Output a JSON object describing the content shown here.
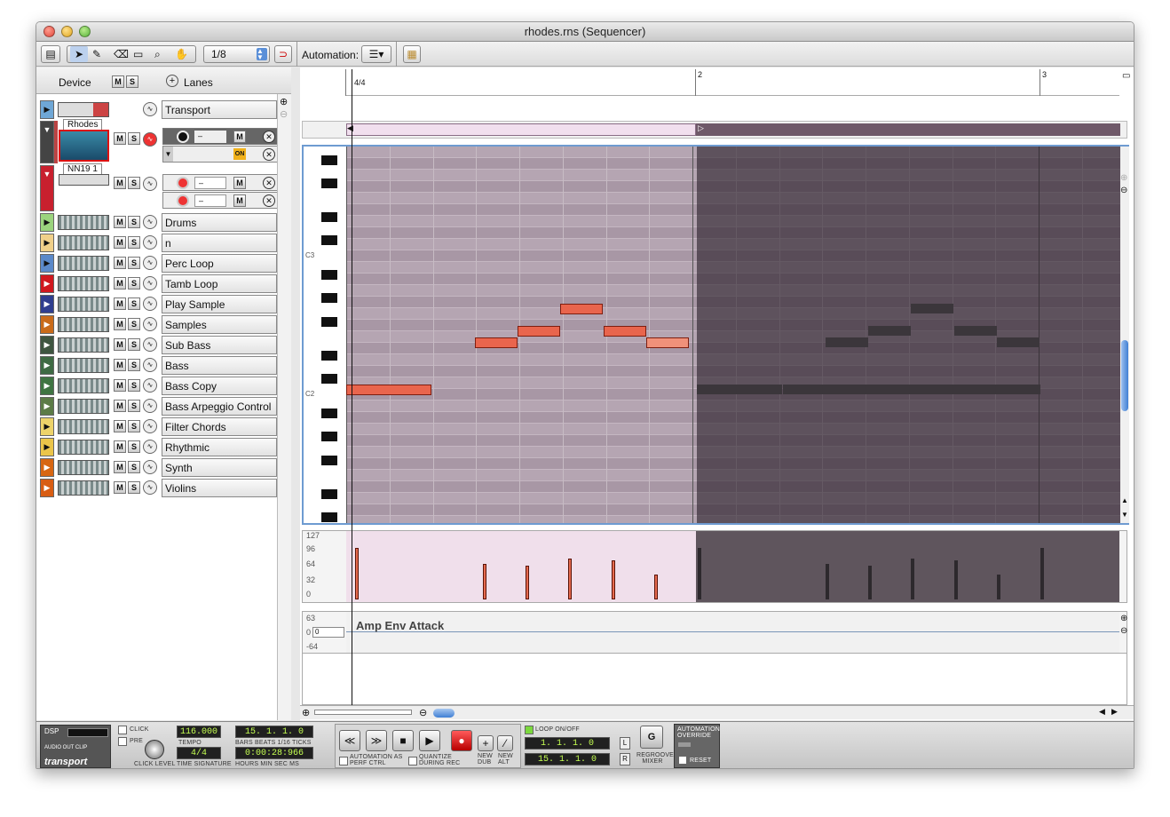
{
  "window": {
    "title": "rhodes.rns (Sequencer)"
  },
  "toolbar": {
    "grid_value": "1/8",
    "automation_label": "Automation:"
  },
  "left_header": {
    "device_label": "Device",
    "mute": "M",
    "solo": "S",
    "lanes_label": "Lanes"
  },
  "tracks": [
    {
      "name": "Transport",
      "color": "#6fa7d6"
    },
    {
      "name": "Rhodes",
      "color": "#444444"
    },
    {
      "name": "NN19 1",
      "color": "#c8202e"
    },
    {
      "name": "Drums",
      "color": "#9bd47e"
    },
    {
      "name": "n",
      "color": "#f0d08a"
    },
    {
      "name": "Perc Loop",
      "color": "#5b89c9"
    },
    {
      "name": "Tamb Loop",
      "color": "#d0181f"
    },
    {
      "name": "Play Sample",
      "color": "#2f3e8f"
    },
    {
      "name": "Samples",
      "color": "#c96b1a"
    },
    {
      "name": "Sub Bass",
      "color": "#3e5540"
    },
    {
      "name": "Bass",
      "color": "#3e6a43"
    },
    {
      "name": "Bass Copy",
      "color": "#3f7442"
    },
    {
      "name": "Bass Arpeggio  Control",
      "color": "#5c7b47"
    },
    {
      "name": "Filter Chords",
      "color": "#edd36a"
    },
    {
      "name": "Rhythmic",
      "color": "#ebc54a"
    },
    {
      "name": "Synth",
      "color": "#d76612"
    },
    {
      "name": "Violins",
      "color": "#d85d13"
    }
  ],
  "rhodes_lane": {
    "on_label": "ON",
    "dash": "–"
  },
  "ruler": {
    "bar1": "4/4",
    "bar2": "2",
    "bar3": "3"
  },
  "keys": {
    "c3": "C3",
    "c2": "C2"
  },
  "velocity": {
    "labels": [
      "127",
      "96",
      "64",
      "32",
      "0"
    ]
  },
  "automation_lane": {
    "top": "63",
    "mid": "0",
    "bottom": "-64",
    "param": "Amp Env Attack",
    "value": "0"
  },
  "transport": {
    "dsp": "DSP",
    "audio_out_clip": "AUDIO OUT CLIP",
    "brand": "transport",
    "click": "CLICK",
    "pre": "PRE",
    "click_level": "CLICK LEVEL",
    "tempo": "116.000",
    "tempo_label": "TEMPO",
    "time_sig": "4/4",
    "time_sig_label": "TIME SIGNATURE",
    "position": "15. 1. 1.   0",
    "position_label": "BARS  BEATS  1/16  TICKS",
    "time": "0:00:28:966",
    "time_label": "HOURS    MIN   SEC     MS",
    "automation_perf": "AUTOMATION AS PERF CTRL",
    "quantize": "QUANTIZE DURING REC",
    "new_dub": "NEW DUB",
    "new_alt": "NEW ALT",
    "loop": "LOOP ON/OFF",
    "loop_left": "1. 1. 1.   0",
    "loop_right": "15. 1. 1.   0",
    "left_marker": "L",
    "right_marker": "R",
    "regroove": "REGROOVE MIXER",
    "auto_override": "AUTOMATION OVERRIDE",
    "reset": "RESET"
  }
}
